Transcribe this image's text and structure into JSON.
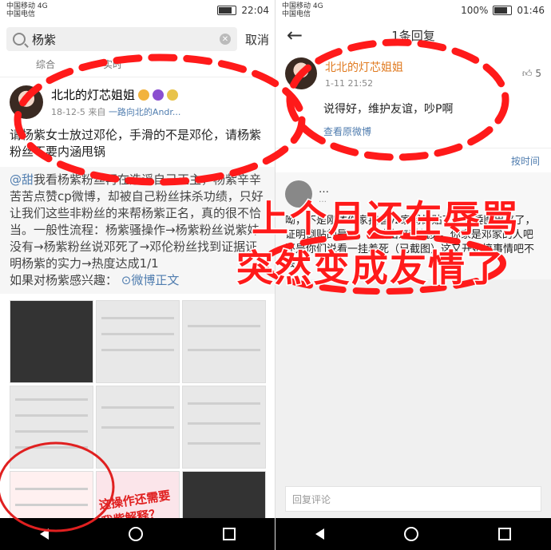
{
  "left": {
    "status": {
      "carrier": "中国移动 4G",
      "carrier2": "中国电信",
      "time": "22:04"
    },
    "search": {
      "query": "杨紫",
      "cancel": "取消"
    },
    "filters": [
      "综合",
      "实时"
    ],
    "post": {
      "author": "北北的灯芯姐姐",
      "date": "18-12-5",
      "source_prefix": "来自",
      "source": "一路向北的Andr...",
      "body": "请杨紫女士放过邓伦，手滑的不是邓伦，请杨紫粉丝不要内涵甩锅",
      "repost_mention": "@甜",
      "repost_text": "我看杨紫粉丝再在造谣自己正主，杨紫辛辛苦苦点赞cp微博，却被自己粉丝抹杀功绩，只好让我们这些非粉丝的来帮杨紫正名，真的很不恰当。一般性流程：杨紫骚操作→杨紫粉丝说紫妹没有→杨紫粉丝说邓死了→邓伦粉丝找到证据证明杨紫的实力→热度达成1/1",
      "interest_label": "如果对杨紫感兴趣：",
      "weibo_link": "微博正文"
    },
    "image_overlay_text": "这操作还需要我紫解释？"
  },
  "right": {
    "status": {
      "carrier": "中国移动 4G",
      "carrier2": "中国电信",
      "battery": "100%",
      "time": "01:46"
    },
    "title": "1条回复",
    "reply": {
      "author": "北北的灯芯姐姐",
      "time": "1-11 21:52",
      "likes": "5",
      "text": "说得好，维护友谊，吵P啊",
      "view_original": "查看原微博"
    },
    "sort_label": "按时间",
    "sub_reply": {
      "author": "…",
      "time": "…",
      "text": "呦，不是刚才你家按着yz家骂倒贴了？石锤图出来了，证明倒贴的是dl，又站出来科机灵。你家是邓家的人吧还是你们说看一挂着死（已截图）这又开始搞事情吧不会。"
    },
    "reply_placeholder": "回复评论"
  },
  "overlay": {
    "line1": "上个月还在辱骂",
    "line2": "突然变成友情了"
  },
  "colors": {
    "overlay_red": "#ff1a1a",
    "link_blue": "#507daf",
    "name_orange": "#e07a1f"
  }
}
